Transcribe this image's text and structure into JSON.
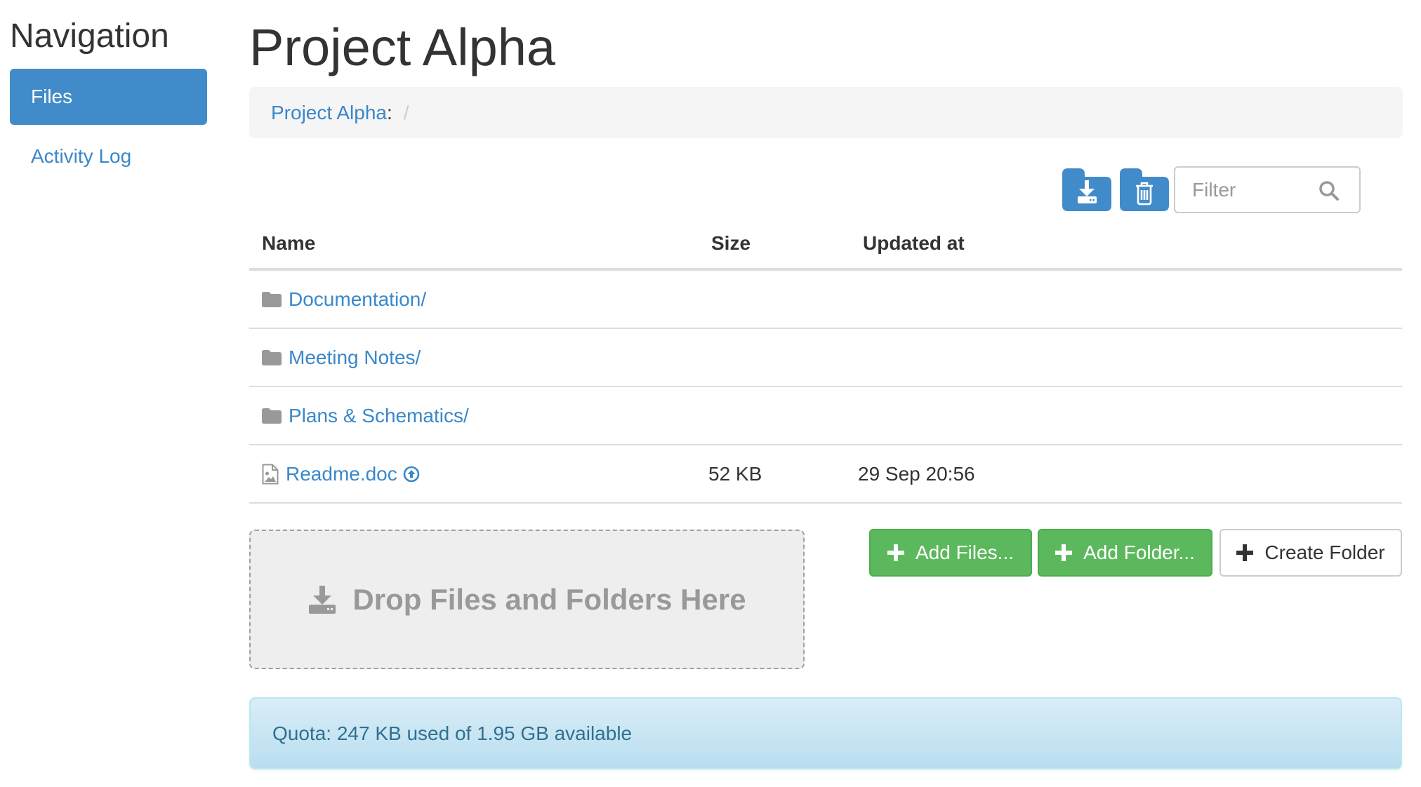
{
  "sidebar": {
    "heading": "Navigation",
    "items": [
      {
        "label": "Files",
        "active": true
      },
      {
        "label": "Activity Log",
        "active": false
      }
    ]
  },
  "page": {
    "title": "Project Alpha"
  },
  "breadcrumb": {
    "root": "Project Alpha",
    "colon": ":",
    "separator": "/"
  },
  "toolbar": {
    "download_icon": "download-icon",
    "delete_icon": "trash-icon",
    "filter_placeholder": "Filter",
    "filter_value": "",
    "search_icon": "search-icon"
  },
  "table": {
    "columns": [
      "Name",
      "Size",
      "Updated at"
    ],
    "rows": [
      {
        "type": "folder",
        "icon": "folder-icon",
        "name": "Documentation/",
        "size": "",
        "updated": ""
      },
      {
        "type": "folder",
        "icon": "folder-icon",
        "name": "Meeting Notes/",
        "size": "",
        "updated": ""
      },
      {
        "type": "folder",
        "icon": "folder-icon",
        "name": "Plans & Schematics/",
        "size": "",
        "updated": ""
      },
      {
        "type": "file",
        "icon": "image-file-icon",
        "name": "Readme.doc",
        "badge_icon": "arrow-circle-up-icon",
        "size": "52 KB",
        "updated": "29 Sep 20:56"
      }
    ]
  },
  "dropzone": {
    "icon": "download-icon",
    "label": "Drop Files and Folders Here"
  },
  "actions": {
    "add_files": "Add Files...",
    "add_folder": "Add Folder...",
    "create_folder": "Create Folder"
  },
  "quota": {
    "text": "Quota: 247 KB used of 1.95 GB available"
  },
  "colors": {
    "primary": "#428bca",
    "link": "#3a87c9",
    "success": "#5cb85c",
    "info_bg": "#d9edf7",
    "info_text": "#31708f"
  }
}
